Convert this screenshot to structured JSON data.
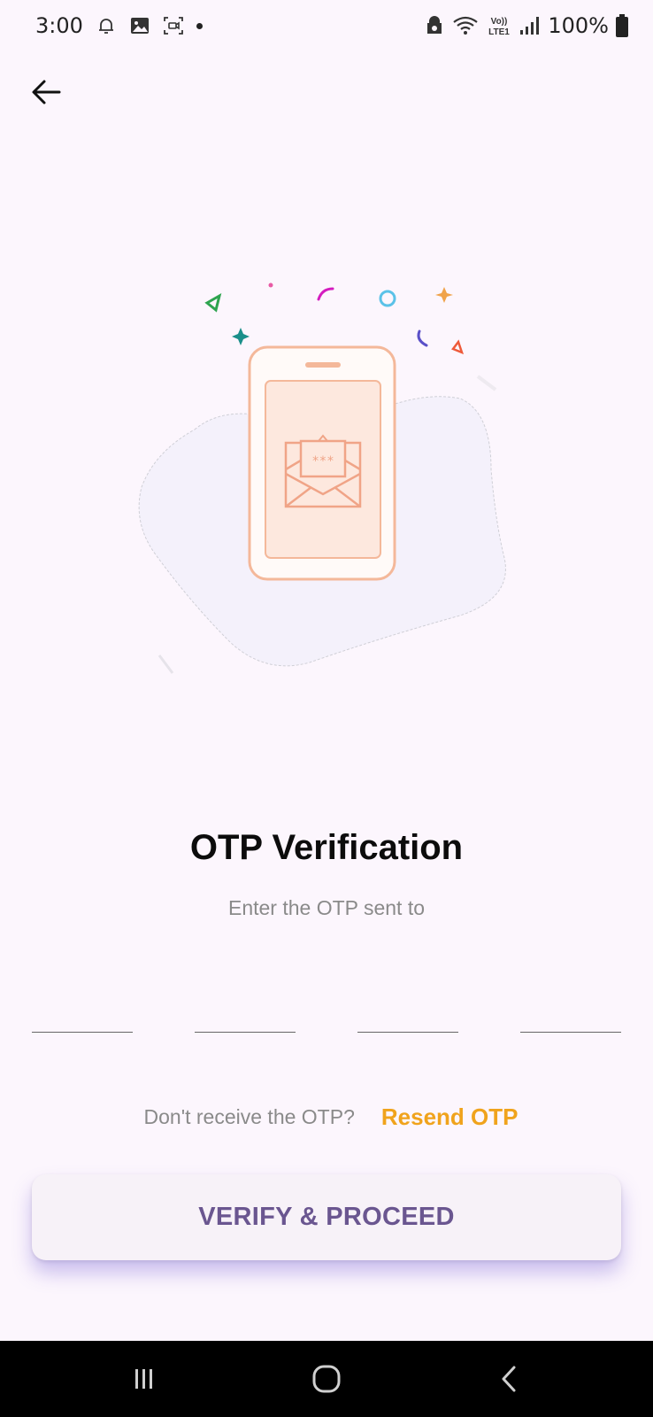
{
  "status_bar": {
    "time": "3:00",
    "battery": "100%",
    "icons": [
      "notification-bell-icon",
      "image-icon",
      "screen-record-icon",
      "dot-icon",
      "vpn-icon",
      "wifi-icon",
      "volte-icon",
      "signal-icon",
      "battery-icon"
    ]
  },
  "header": {
    "back_icon": "arrow-left-icon"
  },
  "illustration": {
    "otp_mask": "***"
  },
  "main": {
    "title": "OTP Verification",
    "subtitle": "Enter the OTP sent to",
    "otp_fields": [
      {
        "value": "",
        "placeholder": ""
      },
      {
        "value": "",
        "placeholder": ""
      },
      {
        "value": "",
        "placeholder": ""
      },
      {
        "value": "",
        "placeholder": ""
      }
    ],
    "resend_question": "Don't receive the OTP?",
    "resend_label": "Resend OTP",
    "verify_label": "VERIFY & PROCEED"
  },
  "colors": {
    "background": "#fcf6fd",
    "accent": "#f0a31c",
    "button_text": "#6a5690",
    "phone_outline": "#f4b89a"
  },
  "nav_bar": {
    "icons": [
      "recent-apps-icon",
      "home-icon",
      "back-nav-icon"
    ]
  }
}
